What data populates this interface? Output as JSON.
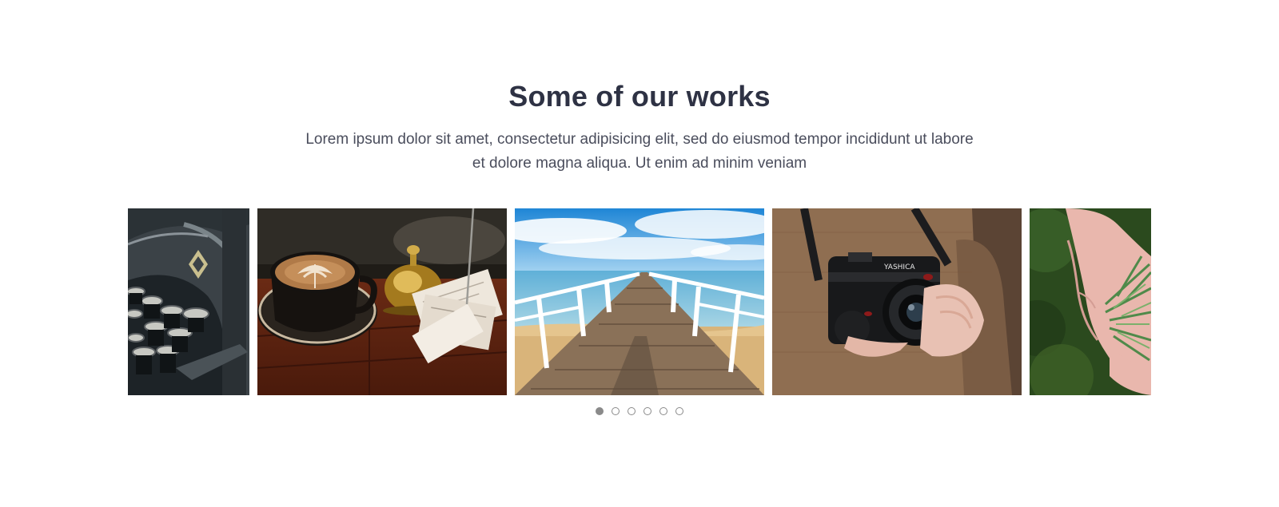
{
  "section": {
    "title": "Some of our works",
    "description": "Lorem ipsum dolor sit amet, consectetur adipisicing elit, sed do eiusmod tempor incididunt ut labore et dolore magna aliqua. Ut enim ad minim veniam"
  },
  "carousel": {
    "slides": [
      {
        "subject": "typewriter"
      },
      {
        "subject": "coffee-and-bell"
      },
      {
        "subject": "pier-over-sea"
      },
      {
        "subject": "camera-in-hands",
        "camera_text": "YASHICA"
      },
      {
        "subject": "hand-with-pine-needles"
      }
    ],
    "dots": {
      "count": 6,
      "active_index": 0
    }
  },
  "colors": {
    "title": "#2e3244",
    "text": "#4a4d5c",
    "dot": "#8a8a8a"
  }
}
